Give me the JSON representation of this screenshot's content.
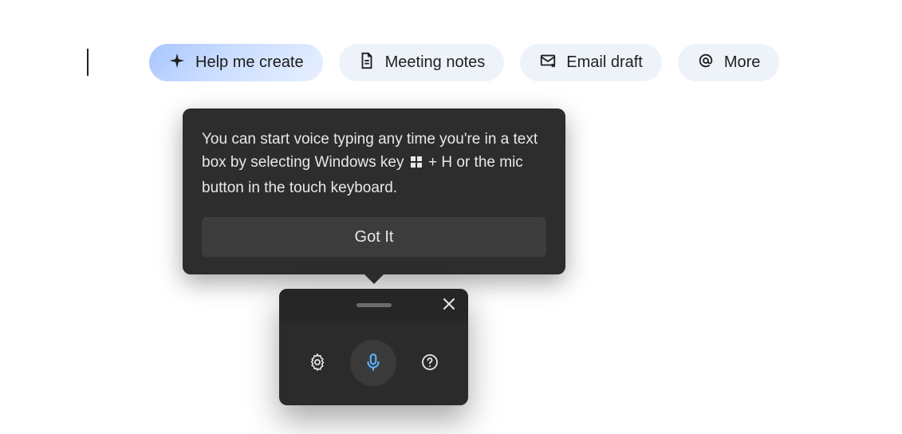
{
  "chips": {
    "help_me_create": {
      "label": "Help me create"
    },
    "meeting_notes": {
      "label": "Meeting notes"
    },
    "email_draft": {
      "label": "Email draft"
    },
    "more": {
      "label": "More"
    }
  },
  "tooltip": {
    "text_before": "You can start voice typing any time you're in a text box by selecting Windows key ",
    "text_after": " + H or the mic button in the touch keyboard.",
    "button_label": "Got It"
  }
}
